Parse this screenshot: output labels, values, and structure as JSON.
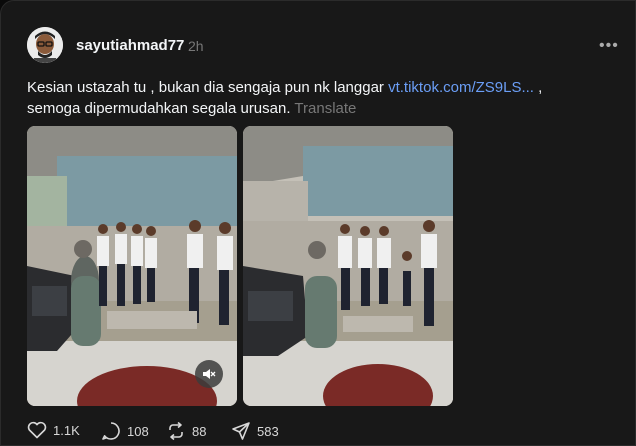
{
  "post": {
    "author": "sayutiahmad77",
    "time": "2h",
    "text_before": "Kesian ustazah tu , bukan dia sengaja pun nk langgar ",
    "link": "vt.tiktok.com/ZS9LS...",
    "text_after": " , semoga dipermudahkan segala urusan.",
    "translate": "Translate"
  },
  "actions": {
    "likes": "1.1K",
    "comments": "108",
    "reposts": "88",
    "shares": "583"
  },
  "icons": {
    "more": "more-icon",
    "like": "heart-icon",
    "comment": "comment-icon",
    "repost": "repost-icon",
    "share": "send-icon",
    "mute": "mute-icon"
  },
  "colors": {
    "background": "#181818",
    "link": "#6b9ef6",
    "muted": "#777777"
  }
}
